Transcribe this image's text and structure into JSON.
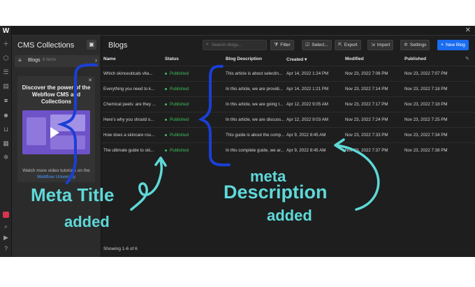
{
  "app": {
    "logo": "W",
    "close_glyph": "✕"
  },
  "collections": {
    "title": "CMS Collections",
    "item_name": "Blogs",
    "item_count": "6 items",
    "promo_title": "Discover the power of the Webflow CMS and Collections",
    "promo_footer": "Watch more video tutorials on the",
    "promo_link": "Webflow University"
  },
  "main": {
    "title": "Blogs",
    "search_placeholder": "Search blogs...",
    "buttons": {
      "filter": "Filter",
      "select": "Select...",
      "export": "Export",
      "import": "Import",
      "settings": "Settings",
      "new_blog": "New Blog"
    },
    "columns": {
      "name": "Name",
      "status": "Status",
      "description": "Blog Description",
      "created": "Created",
      "modified": "Modified",
      "published": "Published"
    },
    "rows": [
      {
        "name": "Which skinceuticals vita...",
        "status": "Published",
        "description": "This article is about selectin...",
        "created": "Apr 14, 2022 1:24 PM",
        "modified": "Nov 23, 2022 7:06 PM",
        "published": "Nov 23, 2022 7:07 PM"
      },
      {
        "name": "Everything you need to k...",
        "status": "Published",
        "description": "In this article, we are providi...",
        "created": "Apr 14, 2022 1:21 PM",
        "modified": "Nov 23, 2022 7:14 PM",
        "published": "Nov 23, 2022 7:18 PM"
      },
      {
        "name": "Chemical peels: are they ...",
        "status": "Published",
        "description": "In this article, we are going t...",
        "created": "Apr 12, 2022 9:05 AM",
        "modified": "Nov 23, 2022 7:17 PM",
        "published": "Nov 23, 2022 7:18 PM"
      },
      {
        "name": "Here's why you should o...",
        "status": "Published",
        "description": "In this article, we are discuss...",
        "created": "Apr 12, 2022 9:03 AM",
        "modified": "Nov 23, 2022 7:24 PM",
        "published": "Nov 23, 2022 7:25 PM"
      },
      {
        "name": "How does a skincare rou...",
        "status": "Published",
        "description": "This guide is about the comp...",
        "created": "Apr 9, 2022 8:45 AM",
        "modified": "Nov 23, 2022 7:33 PM",
        "published": "Nov 23, 2022 7:34 PM"
      },
      {
        "name": "The ultimate guide to ski...",
        "status": "Published",
        "description": "In this complete guide, we ar...",
        "created": "Apr 9, 2022 8:45 AM",
        "modified": "Nov 23, 2022 7:37 PM",
        "published": "Nov 23, 2022 7:38 PM"
      }
    ],
    "showing": "Showing 1-6 of 6"
  },
  "annotations": {
    "meta_title_line1": "Meta Title",
    "meta_title_line2": "added",
    "meta_desc_line1": "meta",
    "meta_desc_line2": "Description",
    "meta_desc_line3": "added",
    "color": "#5fd8d8",
    "bracket_color": "#1a3fd6"
  }
}
